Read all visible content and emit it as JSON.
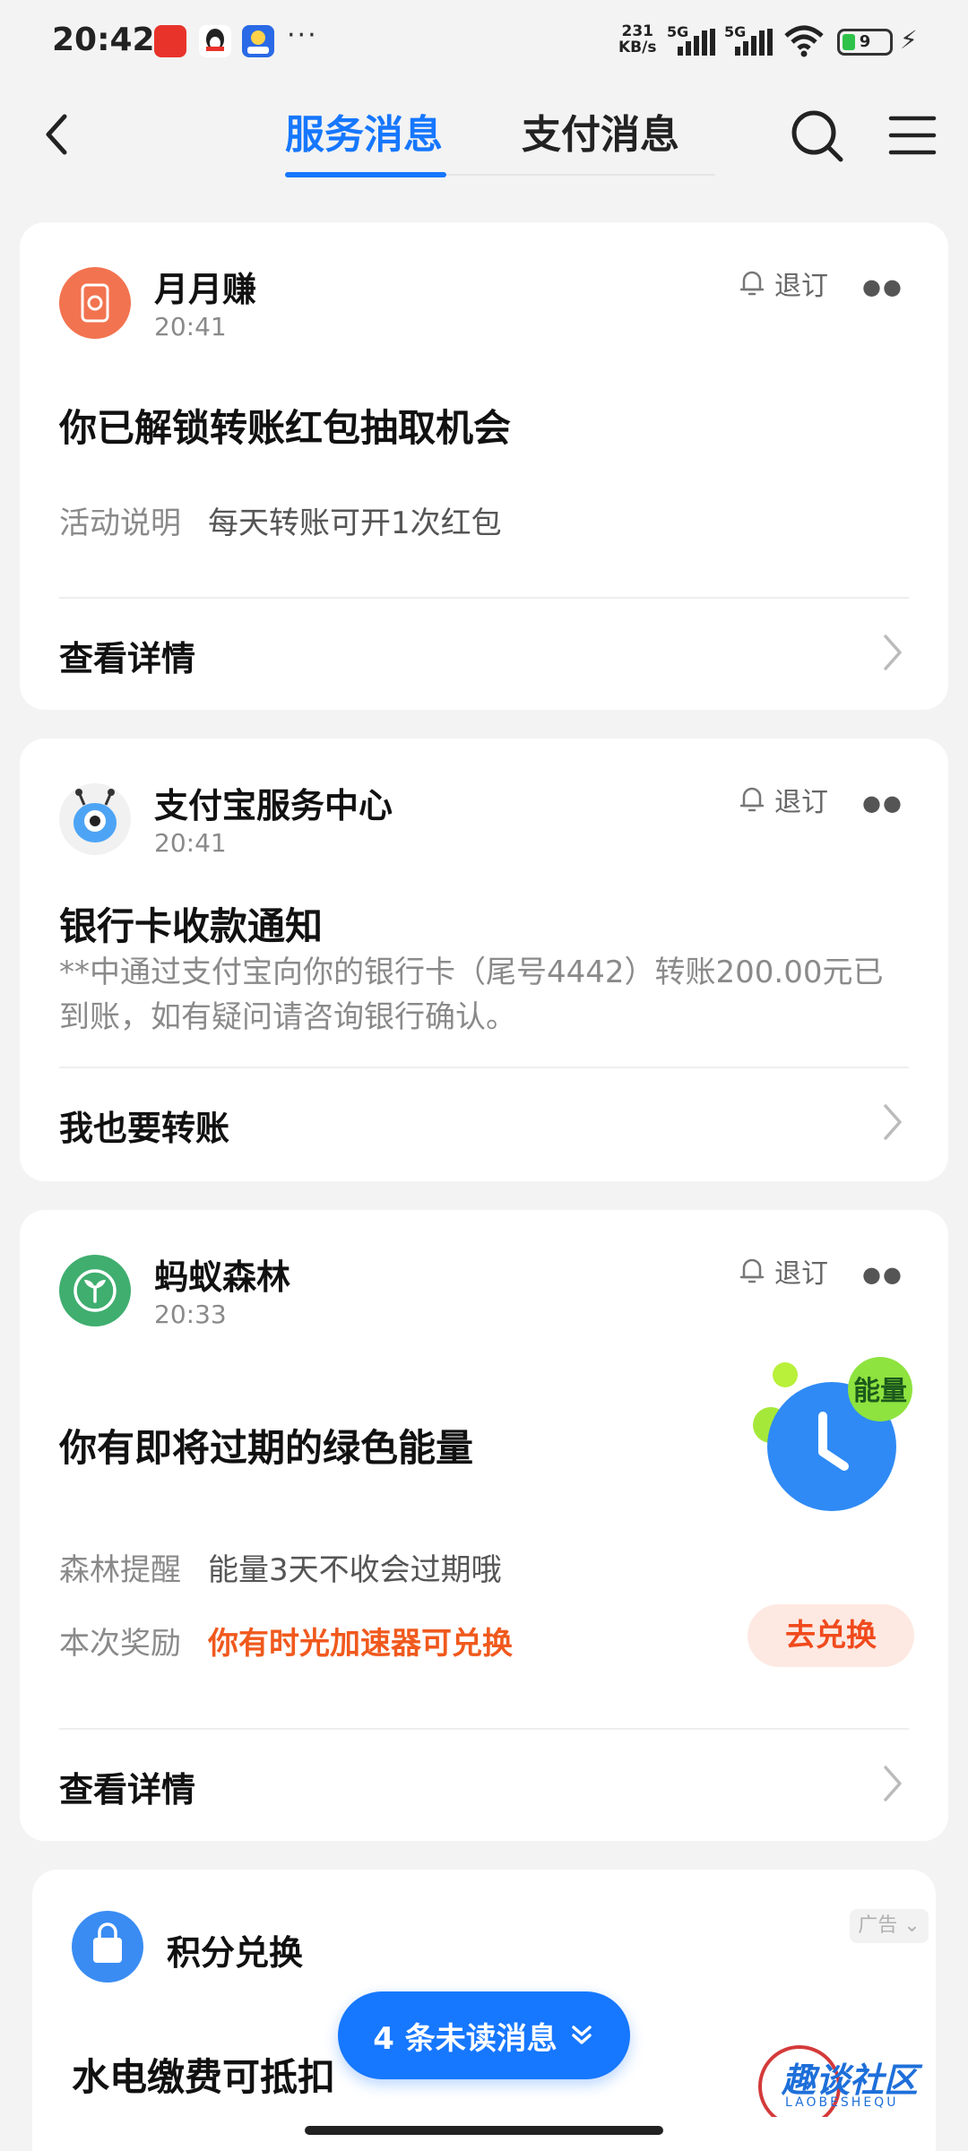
{
  "status_bar": {
    "time": "20:42",
    "net_speed_value": "231",
    "net_speed_unit": "KB/s",
    "network_1": "5G",
    "network_2": "5G",
    "battery": "9",
    "more": "···"
  },
  "header": {
    "tabs": [
      {
        "label": "服务消息",
        "active": true
      },
      {
        "label": "支付消息",
        "active": false
      }
    ]
  },
  "messages": [
    {
      "sender": "月月赚",
      "time": "20:41",
      "unsubscribe": "退订",
      "title": "你已解锁转账红包抽取机会",
      "details": [
        {
          "label": "活动说明",
          "value": "每天转账可开1次红包"
        }
      ],
      "action": "查看详情"
    },
    {
      "sender": "支付宝服务中心",
      "time": "20:41",
      "unsubscribe": "退订",
      "title": "银行卡收款通知",
      "body": "**中通过支付宝向你的银行卡（尾号4442）转账200.00元已到账，如有疑问请咨询银行确认。",
      "action": "我也要转账"
    },
    {
      "sender": "蚂蚁森林",
      "time": "20:33",
      "unsubscribe": "退订",
      "title": "你有即将过期的绿色能量",
      "badge": "能量",
      "details": [
        {
          "label": "森林提醒",
          "value": "能量3天不收会过期哦"
        },
        {
          "label": "本次奖励",
          "value": "你有时光加速器可兑换"
        }
      ],
      "button": "去兑换",
      "action": "查看详情"
    },
    {
      "sender": "积分兑换",
      "ad_label": "广告",
      "title": "水电缴费可抵扣"
    }
  ],
  "unread": {
    "label": "4 条未读消息"
  },
  "watermark": {
    "text": "趣谈社区",
    "sub": "LAOBESHEQU"
  },
  "colors": {
    "accent": "#1677ff",
    "orange": "#f0591d",
    "green": "#3fae6f"
  }
}
